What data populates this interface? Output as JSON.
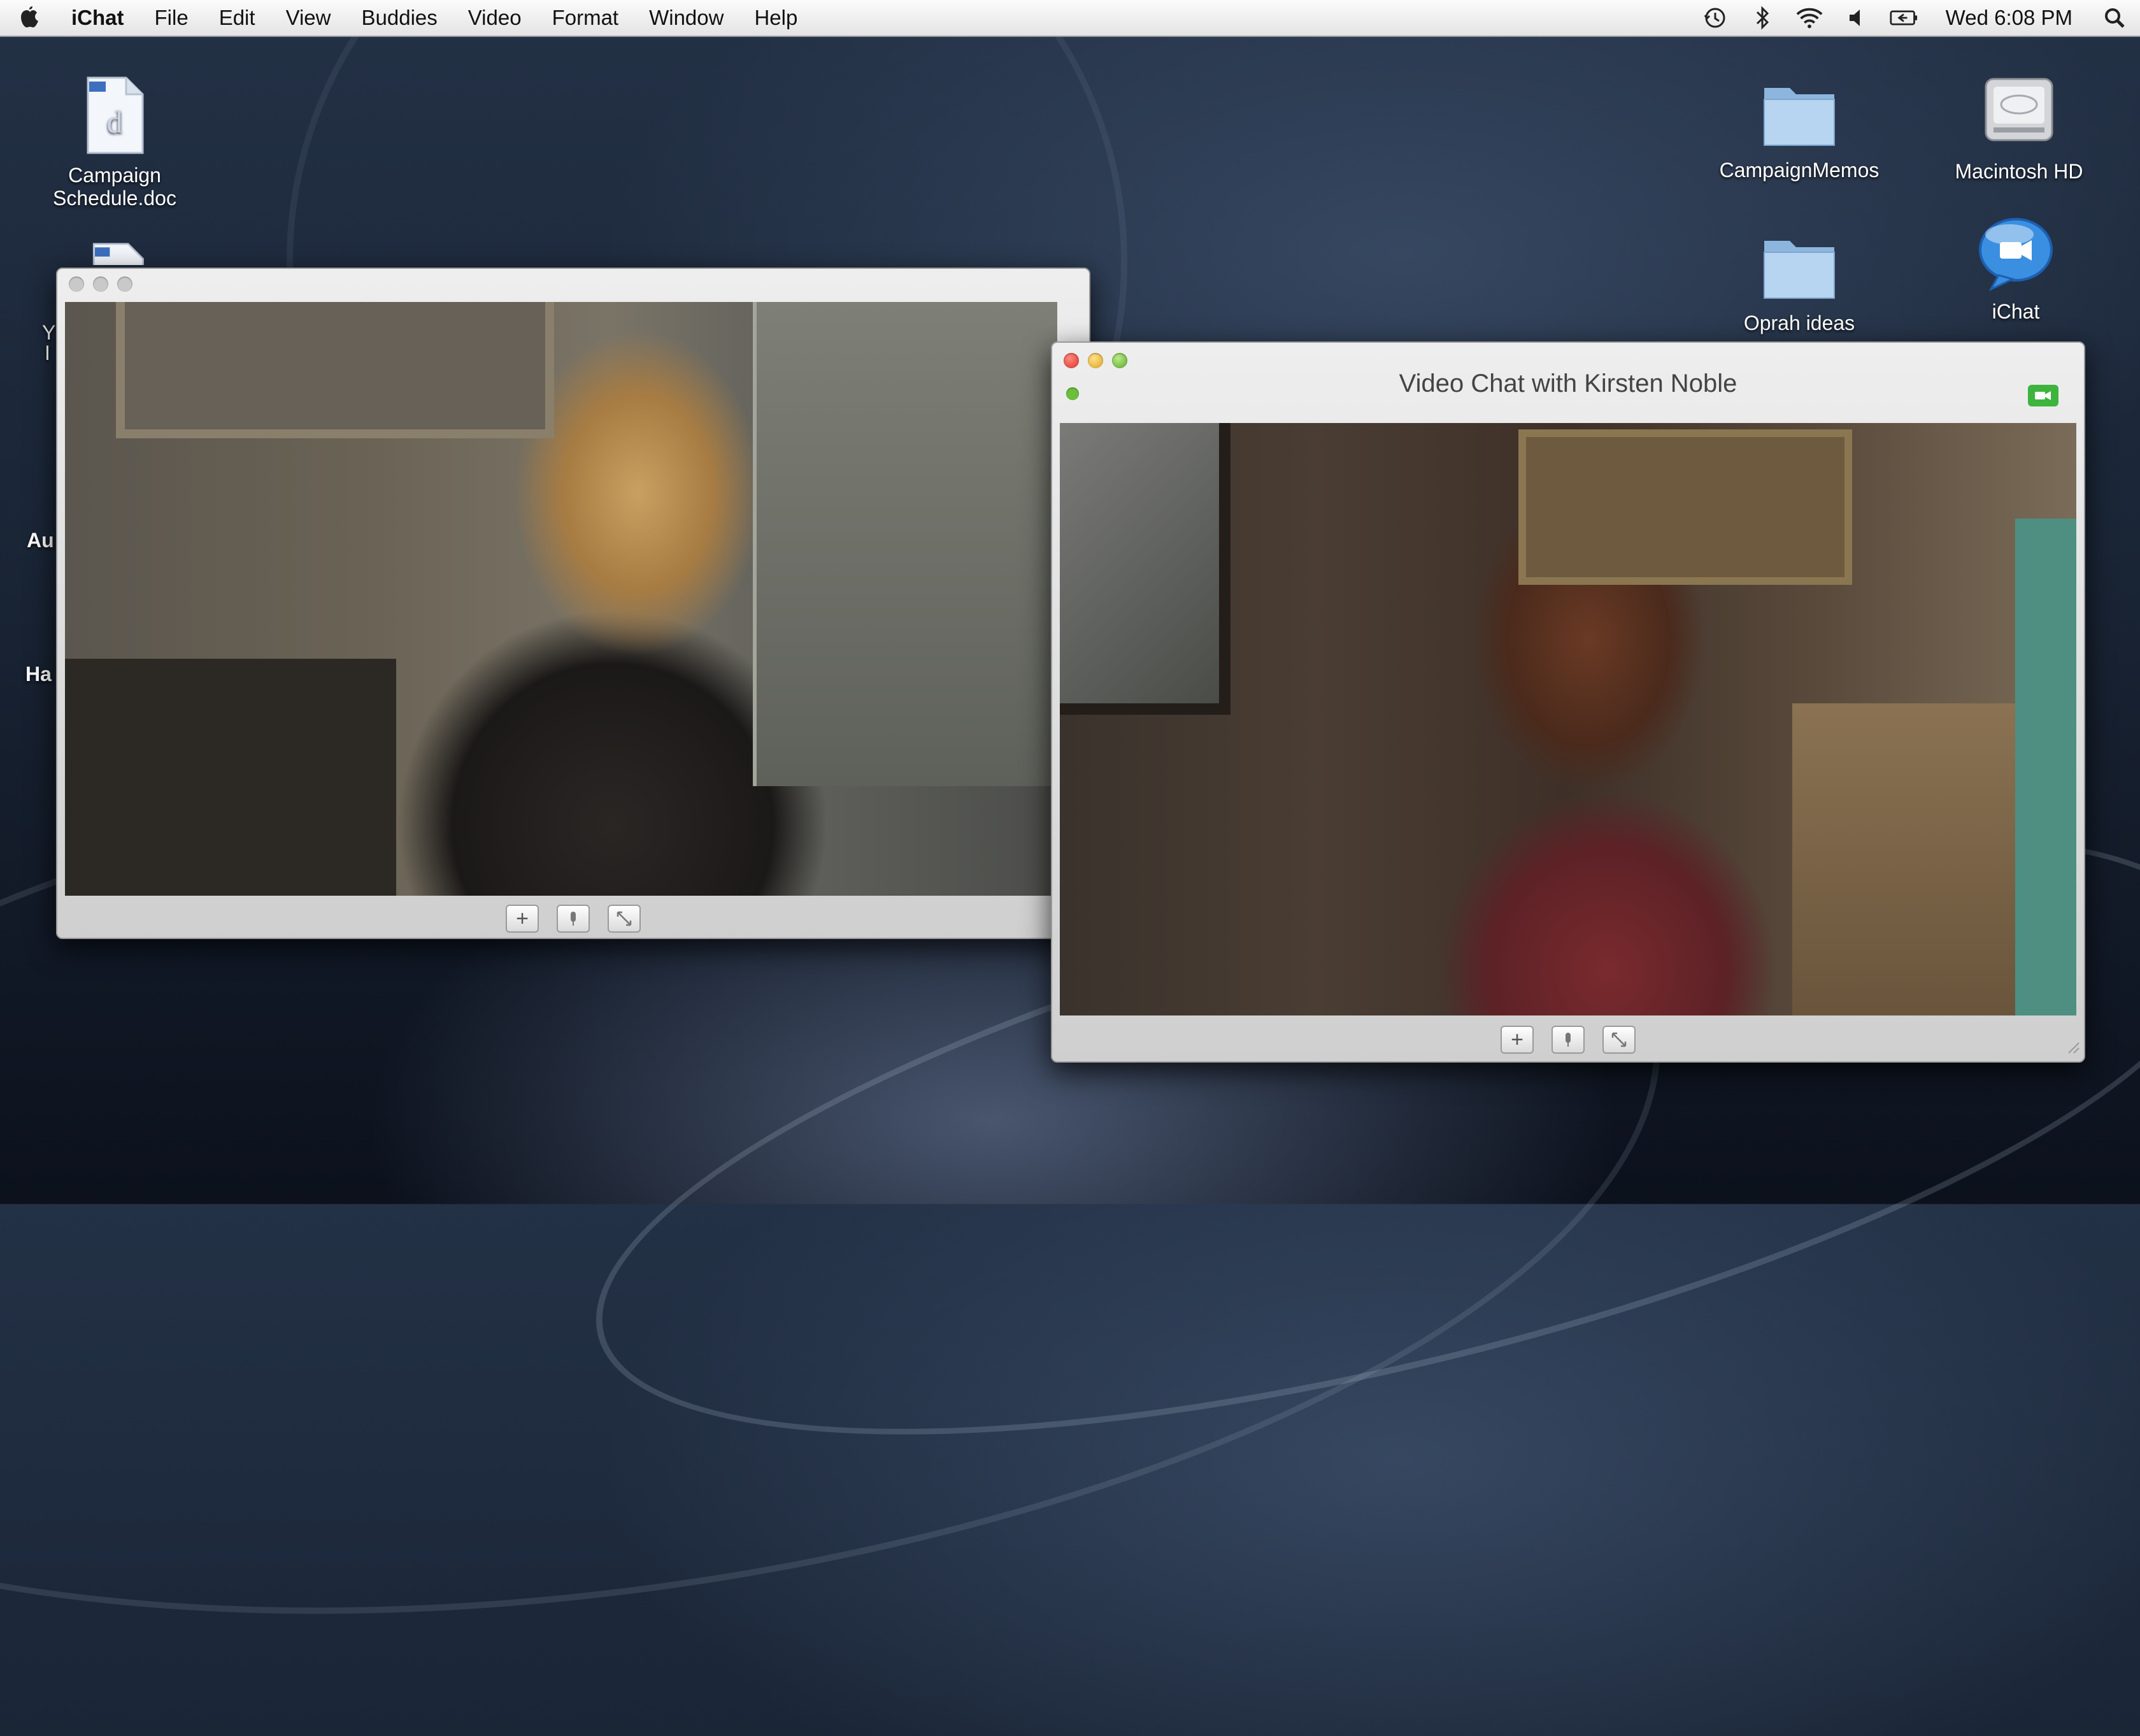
{
  "menubar": {
    "apple_icon": "apple-logo-icon",
    "app_name": "iChat",
    "menus": [
      "File",
      "Edit",
      "View",
      "Buddies",
      "Video",
      "Format",
      "Window",
      "Help"
    ],
    "status_icons": [
      "time-machine-icon",
      "bluetooth-icon",
      "wifi-icon",
      "volume-icon",
      "battery-icon"
    ],
    "clock": "Wed 6:08 PM",
    "search_icon": "spotlight-icon"
  },
  "desktop": {
    "icons": [
      {
        "label": "Campaign\nSchedule.doc",
        "kind": "document-icon"
      },
      {
        "label": "CampaignMemos",
        "kind": "folder-icon"
      },
      {
        "label": "Macintosh HD",
        "kind": "hard-drive-icon"
      },
      {
        "label": "Oprah ideas",
        "kind": "folder-icon"
      },
      {
        "label": "iChat",
        "kind": "ichat-icon"
      }
    ],
    "partial_labels": [
      "Y",
      "I",
      "Au",
      "Ha"
    ]
  },
  "windows": [
    {
      "title": "",
      "controls": [
        "plus-icon",
        "microphone-icon",
        "fullscreen-icon"
      ],
      "control_labels": [
        "+",
        "",
        ""
      ]
    },
    {
      "title": "Video Chat with Kirsten Noble",
      "controls": [
        "plus-icon",
        "microphone-icon",
        "fullscreen-icon"
      ],
      "control_labels": [
        "+",
        "",
        ""
      ],
      "status_color": "#6bbf3a",
      "camera_color": "#3db43d"
    }
  ]
}
